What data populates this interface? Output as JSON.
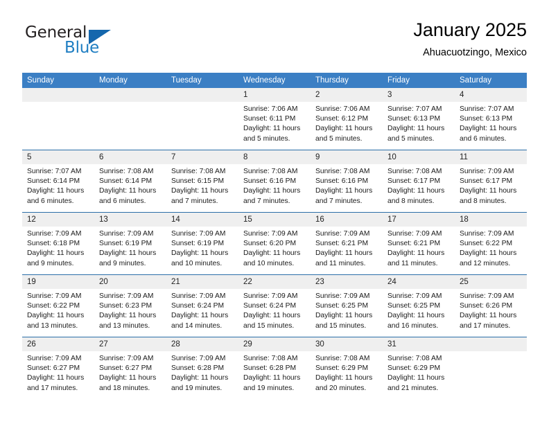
{
  "brand": {
    "name_part1": "General",
    "name_part2": "Blue",
    "logo_icon": "triangle-logo-icon"
  },
  "header": {
    "month_title": "January 2025",
    "location": "Ahuacuotzingo, Mexico"
  },
  "colors": {
    "header_blue": "#3b7fc4",
    "divider_blue": "#2a6ea8",
    "daynum_bg": "#efefef",
    "brand_blue": "#1f7ec2",
    "logo_blue": "#1567ad"
  },
  "calendar": {
    "weekday_headers": [
      "Sunday",
      "Monday",
      "Tuesday",
      "Wednesday",
      "Thursday",
      "Friday",
      "Saturday"
    ],
    "weeks": [
      [
        {
          "day": "",
          "empty": true
        },
        {
          "day": "",
          "empty": true
        },
        {
          "day": "",
          "empty": true
        },
        {
          "day": "1",
          "sunrise": "Sunrise: 7:06 AM",
          "sunset": "Sunset: 6:11 PM",
          "daylight1": "Daylight: 11 hours",
          "daylight2": "and 5 minutes."
        },
        {
          "day": "2",
          "sunrise": "Sunrise: 7:06 AM",
          "sunset": "Sunset: 6:12 PM",
          "daylight1": "Daylight: 11 hours",
          "daylight2": "and 5 minutes."
        },
        {
          "day": "3",
          "sunrise": "Sunrise: 7:07 AM",
          "sunset": "Sunset: 6:13 PM",
          "daylight1": "Daylight: 11 hours",
          "daylight2": "and 5 minutes."
        },
        {
          "day": "4",
          "sunrise": "Sunrise: 7:07 AM",
          "sunset": "Sunset: 6:13 PM",
          "daylight1": "Daylight: 11 hours",
          "daylight2": "and 6 minutes."
        }
      ],
      [
        {
          "day": "5",
          "sunrise": "Sunrise: 7:07 AM",
          "sunset": "Sunset: 6:14 PM",
          "daylight1": "Daylight: 11 hours",
          "daylight2": "and 6 minutes."
        },
        {
          "day": "6",
          "sunrise": "Sunrise: 7:08 AM",
          "sunset": "Sunset: 6:14 PM",
          "daylight1": "Daylight: 11 hours",
          "daylight2": "and 6 minutes."
        },
        {
          "day": "7",
          "sunrise": "Sunrise: 7:08 AM",
          "sunset": "Sunset: 6:15 PM",
          "daylight1": "Daylight: 11 hours",
          "daylight2": "and 7 minutes."
        },
        {
          "day": "8",
          "sunrise": "Sunrise: 7:08 AM",
          "sunset": "Sunset: 6:16 PM",
          "daylight1": "Daylight: 11 hours",
          "daylight2": "and 7 minutes."
        },
        {
          "day": "9",
          "sunrise": "Sunrise: 7:08 AM",
          "sunset": "Sunset: 6:16 PM",
          "daylight1": "Daylight: 11 hours",
          "daylight2": "and 7 minutes."
        },
        {
          "day": "10",
          "sunrise": "Sunrise: 7:08 AM",
          "sunset": "Sunset: 6:17 PM",
          "daylight1": "Daylight: 11 hours",
          "daylight2": "and 8 minutes."
        },
        {
          "day": "11",
          "sunrise": "Sunrise: 7:09 AM",
          "sunset": "Sunset: 6:17 PM",
          "daylight1": "Daylight: 11 hours",
          "daylight2": "and 8 minutes."
        }
      ],
      [
        {
          "day": "12",
          "sunrise": "Sunrise: 7:09 AM",
          "sunset": "Sunset: 6:18 PM",
          "daylight1": "Daylight: 11 hours",
          "daylight2": "and 9 minutes."
        },
        {
          "day": "13",
          "sunrise": "Sunrise: 7:09 AM",
          "sunset": "Sunset: 6:19 PM",
          "daylight1": "Daylight: 11 hours",
          "daylight2": "and 9 minutes."
        },
        {
          "day": "14",
          "sunrise": "Sunrise: 7:09 AM",
          "sunset": "Sunset: 6:19 PM",
          "daylight1": "Daylight: 11 hours",
          "daylight2": "and 10 minutes."
        },
        {
          "day": "15",
          "sunrise": "Sunrise: 7:09 AM",
          "sunset": "Sunset: 6:20 PM",
          "daylight1": "Daylight: 11 hours",
          "daylight2": "and 10 minutes."
        },
        {
          "day": "16",
          "sunrise": "Sunrise: 7:09 AM",
          "sunset": "Sunset: 6:21 PM",
          "daylight1": "Daylight: 11 hours",
          "daylight2": "and 11 minutes."
        },
        {
          "day": "17",
          "sunrise": "Sunrise: 7:09 AM",
          "sunset": "Sunset: 6:21 PM",
          "daylight1": "Daylight: 11 hours",
          "daylight2": "and 11 minutes."
        },
        {
          "day": "18",
          "sunrise": "Sunrise: 7:09 AM",
          "sunset": "Sunset: 6:22 PM",
          "daylight1": "Daylight: 11 hours",
          "daylight2": "and 12 minutes."
        }
      ],
      [
        {
          "day": "19",
          "sunrise": "Sunrise: 7:09 AM",
          "sunset": "Sunset: 6:22 PM",
          "daylight1": "Daylight: 11 hours",
          "daylight2": "and 13 minutes."
        },
        {
          "day": "20",
          "sunrise": "Sunrise: 7:09 AM",
          "sunset": "Sunset: 6:23 PM",
          "daylight1": "Daylight: 11 hours",
          "daylight2": "and 13 minutes."
        },
        {
          "day": "21",
          "sunrise": "Sunrise: 7:09 AM",
          "sunset": "Sunset: 6:24 PM",
          "daylight1": "Daylight: 11 hours",
          "daylight2": "and 14 minutes."
        },
        {
          "day": "22",
          "sunrise": "Sunrise: 7:09 AM",
          "sunset": "Sunset: 6:24 PM",
          "daylight1": "Daylight: 11 hours",
          "daylight2": "and 15 minutes."
        },
        {
          "day": "23",
          "sunrise": "Sunrise: 7:09 AM",
          "sunset": "Sunset: 6:25 PM",
          "daylight1": "Daylight: 11 hours",
          "daylight2": "and 15 minutes."
        },
        {
          "day": "24",
          "sunrise": "Sunrise: 7:09 AM",
          "sunset": "Sunset: 6:25 PM",
          "daylight1": "Daylight: 11 hours",
          "daylight2": "and 16 minutes."
        },
        {
          "day": "25",
          "sunrise": "Sunrise: 7:09 AM",
          "sunset": "Sunset: 6:26 PM",
          "daylight1": "Daylight: 11 hours",
          "daylight2": "and 17 minutes."
        }
      ],
      [
        {
          "day": "26",
          "sunrise": "Sunrise: 7:09 AM",
          "sunset": "Sunset: 6:27 PM",
          "daylight1": "Daylight: 11 hours",
          "daylight2": "and 17 minutes."
        },
        {
          "day": "27",
          "sunrise": "Sunrise: 7:09 AM",
          "sunset": "Sunset: 6:27 PM",
          "daylight1": "Daylight: 11 hours",
          "daylight2": "and 18 minutes."
        },
        {
          "day": "28",
          "sunrise": "Sunrise: 7:09 AM",
          "sunset": "Sunset: 6:28 PM",
          "daylight1": "Daylight: 11 hours",
          "daylight2": "and 19 minutes."
        },
        {
          "day": "29",
          "sunrise": "Sunrise: 7:08 AM",
          "sunset": "Sunset: 6:28 PM",
          "daylight1": "Daylight: 11 hours",
          "daylight2": "and 19 minutes."
        },
        {
          "day": "30",
          "sunrise": "Sunrise: 7:08 AM",
          "sunset": "Sunset: 6:29 PM",
          "daylight1": "Daylight: 11 hours",
          "daylight2": "and 20 minutes."
        },
        {
          "day": "31",
          "sunrise": "Sunrise: 7:08 AM",
          "sunset": "Sunset: 6:29 PM",
          "daylight1": "Daylight: 11 hours",
          "daylight2": "and 21 minutes."
        },
        {
          "day": "",
          "empty": true
        }
      ]
    ]
  }
}
